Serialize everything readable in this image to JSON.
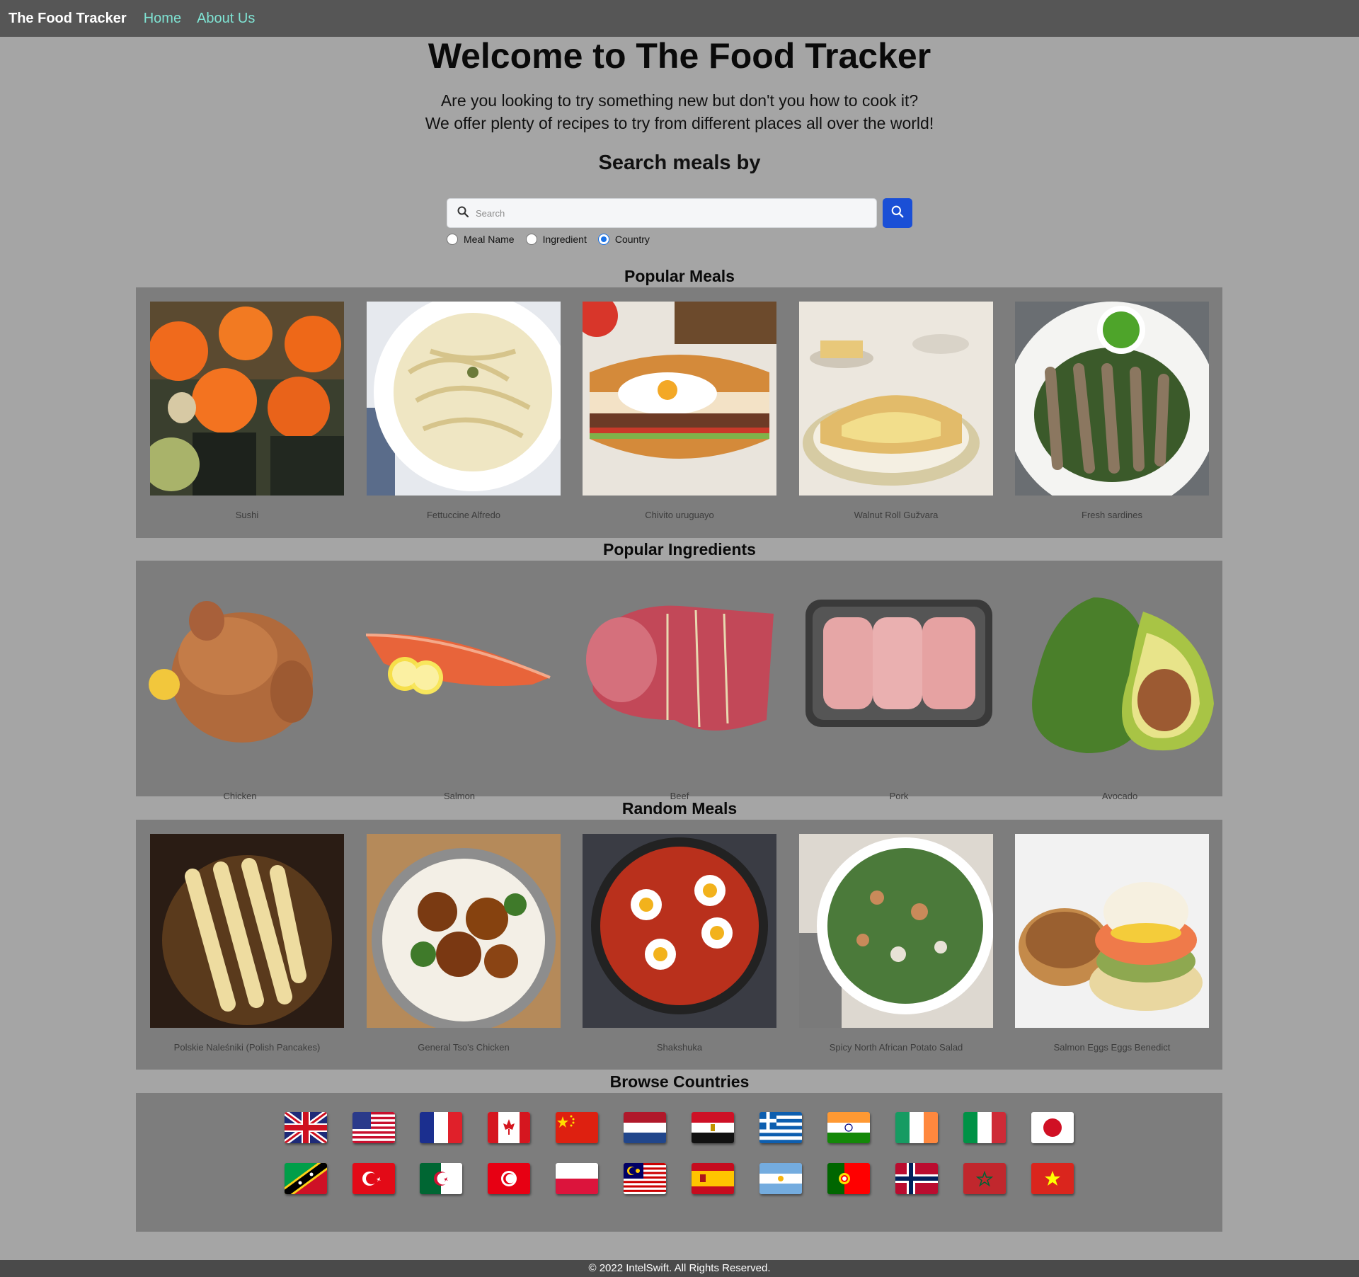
{
  "nav": {
    "brand": "The Food Tracker",
    "links": [
      "Home",
      "About Us"
    ]
  },
  "hero": {
    "title": "Welcome to The Food Tracker",
    "line1": "Are you looking to try something new but don't you how to cook it?",
    "line2": "We offer plenty of recipes to try from different places all over the world!"
  },
  "search": {
    "heading": "Search meals by",
    "placeholder": "Search",
    "value": "",
    "options": [
      "Meal Name",
      "Ingredient",
      "Country"
    ],
    "selected": "Country"
  },
  "popular_meals": {
    "title": "Popular Meals",
    "items": [
      "Sushi",
      "Fettuccine Alfredo",
      "Chivito uruguayo",
      "Walnut Roll Gužvara",
      "Fresh sardines"
    ]
  },
  "popular_ingredients": {
    "title": "Popular Ingredients",
    "items": [
      "Chicken",
      "Salmon",
      "Beef",
      "Pork",
      "Avocado"
    ]
  },
  "random_meals": {
    "title": "Random Meals",
    "items": [
      "Polskie Naleśniki (Polish Pancakes)",
      "General Tso's Chicken",
      "Shakshuka",
      "Spicy North African Potato Salad",
      "Salmon Eggs Eggs Benedict"
    ]
  },
  "browse_countries": {
    "title": "Browse Countries",
    "flags": [
      "united-kingdom-flag",
      "united-states-flag",
      "france-flag",
      "canada-flag",
      "china-flag",
      "netherlands-flag",
      "egypt-flag",
      "greece-flag",
      "india-flag",
      "ireland-flag",
      "italy-flag",
      "japan-flag",
      "saint-kitts-flag",
      "turkey-flag",
      "algeria-flag",
      "tunisia-flag",
      "poland-flag",
      "malaysia-flag",
      "spain-flag",
      "argentina-flag",
      "portugal-flag",
      "norway-flag",
      "morocco-flag",
      "vietnam-flag"
    ]
  },
  "footer": {
    "text": "© 2022 IntelSwift. All Rights Reserved."
  },
  "colors": {
    "navbar": "#565656",
    "page_bg": "#a5a5a5",
    "panel_bg": "#7d7d7d",
    "nav_link": "#7fe3d3",
    "search_button": "#1a4fd6",
    "radio_accent": "#1a73e8"
  }
}
